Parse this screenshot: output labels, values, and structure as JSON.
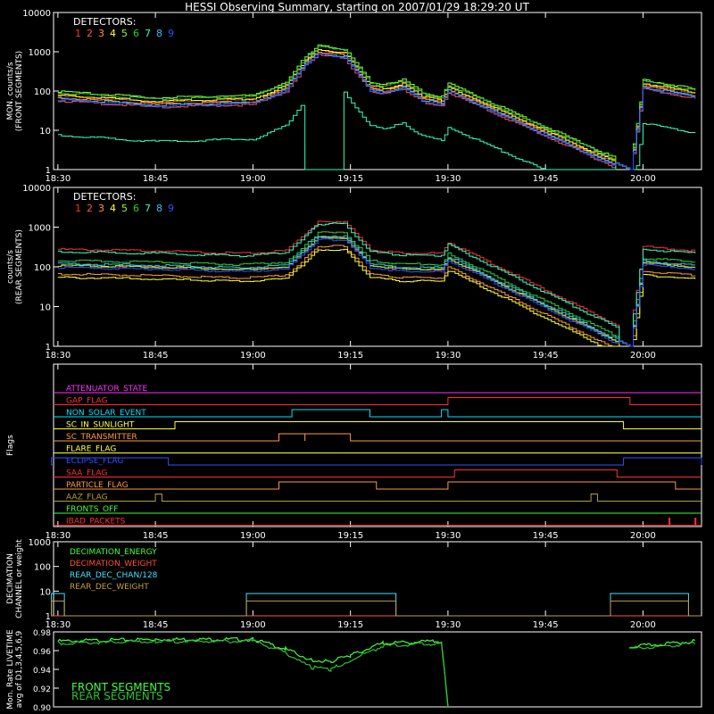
{
  "title": "HESSI Observing Summary, starting on 2007/01/29 18:29:20 UT",
  "colors": {
    "det": [
      "#ff3030",
      "#ff5050",
      "#ff9a30",
      "#ffff30",
      "#90ff30",
      "#30d030",
      "#30ffc0",
      "#30c0ff",
      "#3050ff"
    ],
    "axis": "#ffffff",
    "attenuator": "#ff30ff",
    "gap": "#ff3030",
    "nonsolar": "#00e0ff",
    "sunlight": "#ffff40",
    "transmitter": "#ff9a40",
    "flare": "#ffff40",
    "eclipse": "#3050ff",
    "saa": "#ff3030",
    "particle": "#ff9a40",
    "aaz": "#b0a040",
    "fronts": "#40ff40",
    "packets": "#ff3030",
    "dec_energy": "#40ff40",
    "dec_weight": "#ff5030",
    "rear_chan": "#40e0ff",
    "rear_weight": "#c0a040",
    "front_seg": "#40ff40",
    "rear_seg": "#30c030"
  },
  "chart_data": [
    {
      "type": "line",
      "panel": "front",
      "ylabel": "MON. counts/s\n(FRONT SEGMENTS)",
      "yscale": "log",
      "ylim": [
        1,
        10000
      ],
      "yticks": [
        "1",
        "10",
        "100",
        "1000",
        "10000"
      ],
      "xlim": [
        "18:29:20",
        "20:09:00"
      ],
      "xticks": [
        "18:30",
        "18:45",
        "19:00",
        "19:15",
        "19:30",
        "19:45",
        "20:00"
      ],
      "legend_title": "DETECTORS:",
      "legend_labels": [
        "1",
        "2",
        "3",
        "4",
        "5",
        "6",
        "7",
        "8",
        "9"
      ],
      "x": [
        "18:30",
        "18:45",
        "19:00",
        "19:05",
        "19:08",
        "19:10",
        "19:14",
        "19:18",
        "19:20",
        "19:23",
        "19:26",
        "19:29",
        "19:30",
        "19:58",
        "20:00",
        "20:08"
      ],
      "series_base": [
        75,
        52,
        60,
        130,
        600,
        1100,
        900,
        130,
        110,
        150,
        70,
        55,
        120,
        1,
        150,
        85
      ],
      "series_scale": [
        1.0,
        0.75,
        0.9,
        1.05,
        1.3,
        1.2,
        0.1,
        0.85,
        0.8
      ],
      "series_note_det7": "detector 7 drops to 1 between 19:09 and 19:14"
    },
    {
      "type": "line",
      "panel": "rear",
      "ylabel": "counts/s\n(REAR SEGMENTS)",
      "yscale": "log",
      "ylim": [
        1,
        10000
      ],
      "yticks": [
        "1",
        "10",
        "100",
        "1000",
        "10000"
      ],
      "xlim": [
        "18:29:20",
        "20:09:00"
      ],
      "xticks": [
        "18:30",
        "18:45",
        "19:00",
        "19:15",
        "19:30",
        "19:45",
        "20:00"
      ],
      "legend_title": "DETECTORS:",
      "legend_labels": [
        "1",
        "2",
        "3",
        "4",
        "5",
        "6",
        "7",
        "8",
        "9"
      ],
      "x": [
        "18:30",
        "18:45",
        "18:58",
        "19:05",
        "19:08",
        "19:10",
        "19:14",
        "19:18",
        "19:22",
        "19:29",
        "19:30",
        "19:58",
        "20:00",
        "20:08"
      ],
      "series_base": [
        120,
        110,
        95,
        110,
        300,
        600,
        600,
        120,
        100,
        95,
        180,
        1,
        140,
        110
      ],
      "series_scale": [
        2.3,
        0.9,
        0.55,
        0.45,
        0.9,
        1.2,
        2.0,
        1.0,
        0.8
      ]
    },
    {
      "type": "table",
      "panel": "flags",
      "ylabel": "Flags",
      "xticks": [
        "18:30",
        "18:45",
        "19:00",
        "19:15",
        "19:30",
        "19:45",
        "20:00"
      ],
      "rows": [
        {
          "label": "ATTENUATOR_STATE",
          "color_key": "attenuator",
          "intervals": []
        },
        {
          "label": "GAP_FLAG",
          "color_key": "gap",
          "intervals": [
            [
              "19:30",
              "19:58"
            ]
          ]
        },
        {
          "label": "NON_SOLAR_EVENT",
          "color_key": "nonsolar",
          "intervals": [
            [
              "19:06",
              "19:18"
            ],
            [
              "19:29",
              "19:30"
            ]
          ]
        },
        {
          "label": "SC_IN_SUNLIGHT",
          "color_key": "sunlight",
          "intervals": [
            [
              "18:48",
              "19:57"
            ]
          ]
        },
        {
          "label": "SC_TRANSMITTER",
          "color_key": "transmitter",
          "intervals": [
            [
              "19:04",
              "19:08"
            ],
            [
              "19:08",
              "19:15"
            ]
          ]
        },
        {
          "label": "FLARE_FLAG",
          "color_key": "flare",
          "intervals": []
        },
        {
          "label": "ECLIPSE_FLAG",
          "color_key": "eclipse",
          "intervals": [
            [
              "18:29",
              "18:47"
            ],
            [
              "19:57",
              "20:09"
            ]
          ]
        },
        {
          "label": "SAA_FLAG",
          "color_key": "saa",
          "intervals": [
            [
              "19:31",
              "19:56"
            ]
          ]
        },
        {
          "label": "PARTICLE_FLAG",
          "color_key": "particle",
          "intervals": [
            [
              "19:04",
              "19:19"
            ],
            [
              "19:30",
              "20:05"
            ]
          ]
        },
        {
          "label": "AAZ_FLAG",
          "color_key": "aaz",
          "intervals": [
            [
              "18:45",
              "18:46"
            ],
            [
              "19:52",
              "19:53"
            ]
          ]
        },
        {
          "label": "FRONTS_OFF",
          "color_key": "fronts",
          "intervals": []
        },
        {
          "label": "IBAD_PACKETS",
          "color_key": "packets",
          "intervals": [
            [
              "20:04",
              "20:04"
            ],
            [
              "20:08",
              "20:08"
            ]
          ]
        }
      ]
    },
    {
      "type": "line",
      "panel": "decimation",
      "ylabel": "DECIMATION\nCHANNEL or weight",
      "yscale": "log",
      "ylim": [
        1,
        1000
      ],
      "yticks": [
        "1",
        "10",
        "100",
        "1000"
      ],
      "xticks": [
        "18:30",
        "18:45",
        "19:00",
        "19:15",
        "19:30",
        "19:45",
        "20:00"
      ],
      "legend_labels": [
        "DECIMATION_ENERGY",
        "DECIMATION_WEIGHT",
        "REAR_DEC_CHAN/128",
        "REAR_DEC_WEIGHT"
      ],
      "intervals": [
        [
          "18:29",
          "18:31"
        ],
        [
          "18:59",
          "19:22"
        ],
        [
          "19:55",
          "20:07"
        ]
      ],
      "values_on": {
        "REAR_DEC_CHAN/128": 8,
        "REAR_DEC_WEIGHT": 4,
        "DECIMATION_WEIGHT": 1,
        "DECIMATION_ENERGY": 1
      }
    },
    {
      "type": "line",
      "panel": "livetime",
      "ylabel": "Mon. Rate LIVETIME\navg of D1,3,4,5,6,9",
      "ylim": [
        0.9,
        0.98
      ],
      "yticks": [
        "0.90",
        "0.92",
        "0.94",
        "0.96",
        "0.98"
      ],
      "legend_labels": [
        "FRONT SEGMENTS",
        "REAR SEGMENTS"
      ],
      "series": [
        {
          "name": "FRONT SEGMENTS",
          "x": [
            "18:30",
            "18:45",
            "19:00",
            "19:05",
            "19:09",
            "19:12",
            "19:15",
            "19:20",
            "19:29",
            "19:30",
            "19:58",
            "20:08"
          ],
          "values": [
            0.97,
            0.972,
            0.972,
            0.962,
            0.95,
            0.948,
            0.955,
            0.968,
            0.97,
            0.9,
            0.964,
            0.97
          ]
        },
        {
          "name": "REAR SEGMENTS",
          "x": [
            "18:30",
            "18:45",
            "19:00",
            "19:05",
            "19:09",
            "19:12",
            "19:15",
            "19:20",
            "19:29",
            "19:30",
            "19:58",
            "20:08"
          ],
          "values": [
            0.968,
            0.97,
            0.97,
            0.958,
            0.942,
            0.94,
            0.95,
            0.965,
            0.968,
            0.9,
            0.962,
            0.968
          ]
        }
      ]
    }
  ]
}
